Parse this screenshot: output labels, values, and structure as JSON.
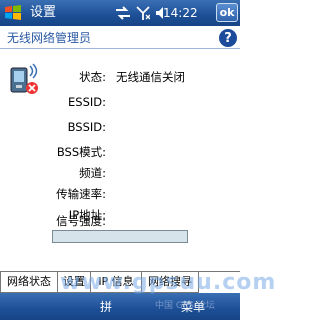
{
  "titlebar": {
    "title": "设置",
    "time": "14:22",
    "ok_label": "ok"
  },
  "header": {
    "title": "无线网络管理员"
  },
  "fields": [
    {
      "label": "状态:",
      "value": "无线通信关闭"
    },
    {
      "label": "ESSID:",
      "value": ""
    },
    {
      "label": "BSSID:",
      "value": ""
    },
    {
      "label": "BSS模式:",
      "value": ""
    },
    {
      "label": "频道:",
      "value": ""
    },
    {
      "label": "传输速率:",
      "value": ""
    },
    {
      "label": "IP地址:",
      "value": ""
    },
    {
      "label": "信号强度:",
      "value": ""
    }
  ],
  "tabs": [
    "网络状态",
    "设置",
    "IP 信息",
    "网络搜寻"
  ],
  "menu": {
    "left": "拼",
    "right": "菜单"
  },
  "watermark": {
    "text": "www.gpsuu.com",
    "sub": "中国 GPS 论坛"
  },
  "colors": {
    "titlebar": "#1d4f96",
    "header_text": "#2a59a5",
    "help": "#1b4b9a",
    "signal_bar": "#d7e3ea"
  }
}
